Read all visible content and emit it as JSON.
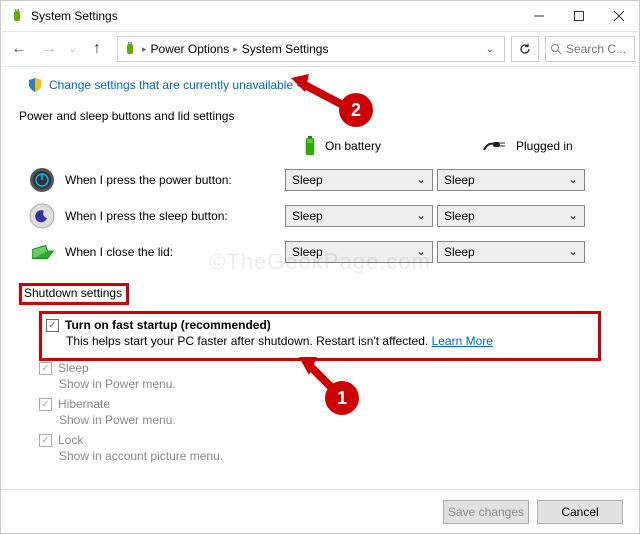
{
  "window": {
    "title": "System Settings"
  },
  "breadcrumb": {
    "item1": "Power Options",
    "item2": "System Settings"
  },
  "search": {
    "placeholder": "Search C..."
  },
  "change_link": "Change settings that are currently unavailable",
  "section_label": "Power and sleep buttons and lid settings",
  "col_headers": {
    "battery": "On battery",
    "plugged": "Plugged in"
  },
  "rows": {
    "power": {
      "label": "When I press the power button:",
      "battery": "Sleep",
      "plugged": "Sleep"
    },
    "sleep": {
      "label": "When I press the sleep button:",
      "battery": "Sleep",
      "plugged": "Sleep"
    },
    "lid": {
      "label": "When I close the lid:",
      "battery": "Sleep",
      "plugged": "Sleep"
    }
  },
  "shutdown_title": "Shutdown settings",
  "shutdown": {
    "fast_startup": {
      "label": "Turn on fast startup (recommended)",
      "desc": "This helps start your PC faster after shutdown. Restart isn't affected. ",
      "learn_more": "Learn More"
    },
    "sleep": {
      "label": "Sleep",
      "desc": "Show in Power menu."
    },
    "hibernate": {
      "label": "Hibernate",
      "desc": "Show in Power menu."
    },
    "lock": {
      "label": "Lock",
      "desc": "Show in account picture menu."
    }
  },
  "footer": {
    "save": "Save changes",
    "cancel": "Cancel"
  },
  "markers": {
    "1": "1",
    "2": "2"
  },
  "watermark": "©TheGeekPage.com"
}
